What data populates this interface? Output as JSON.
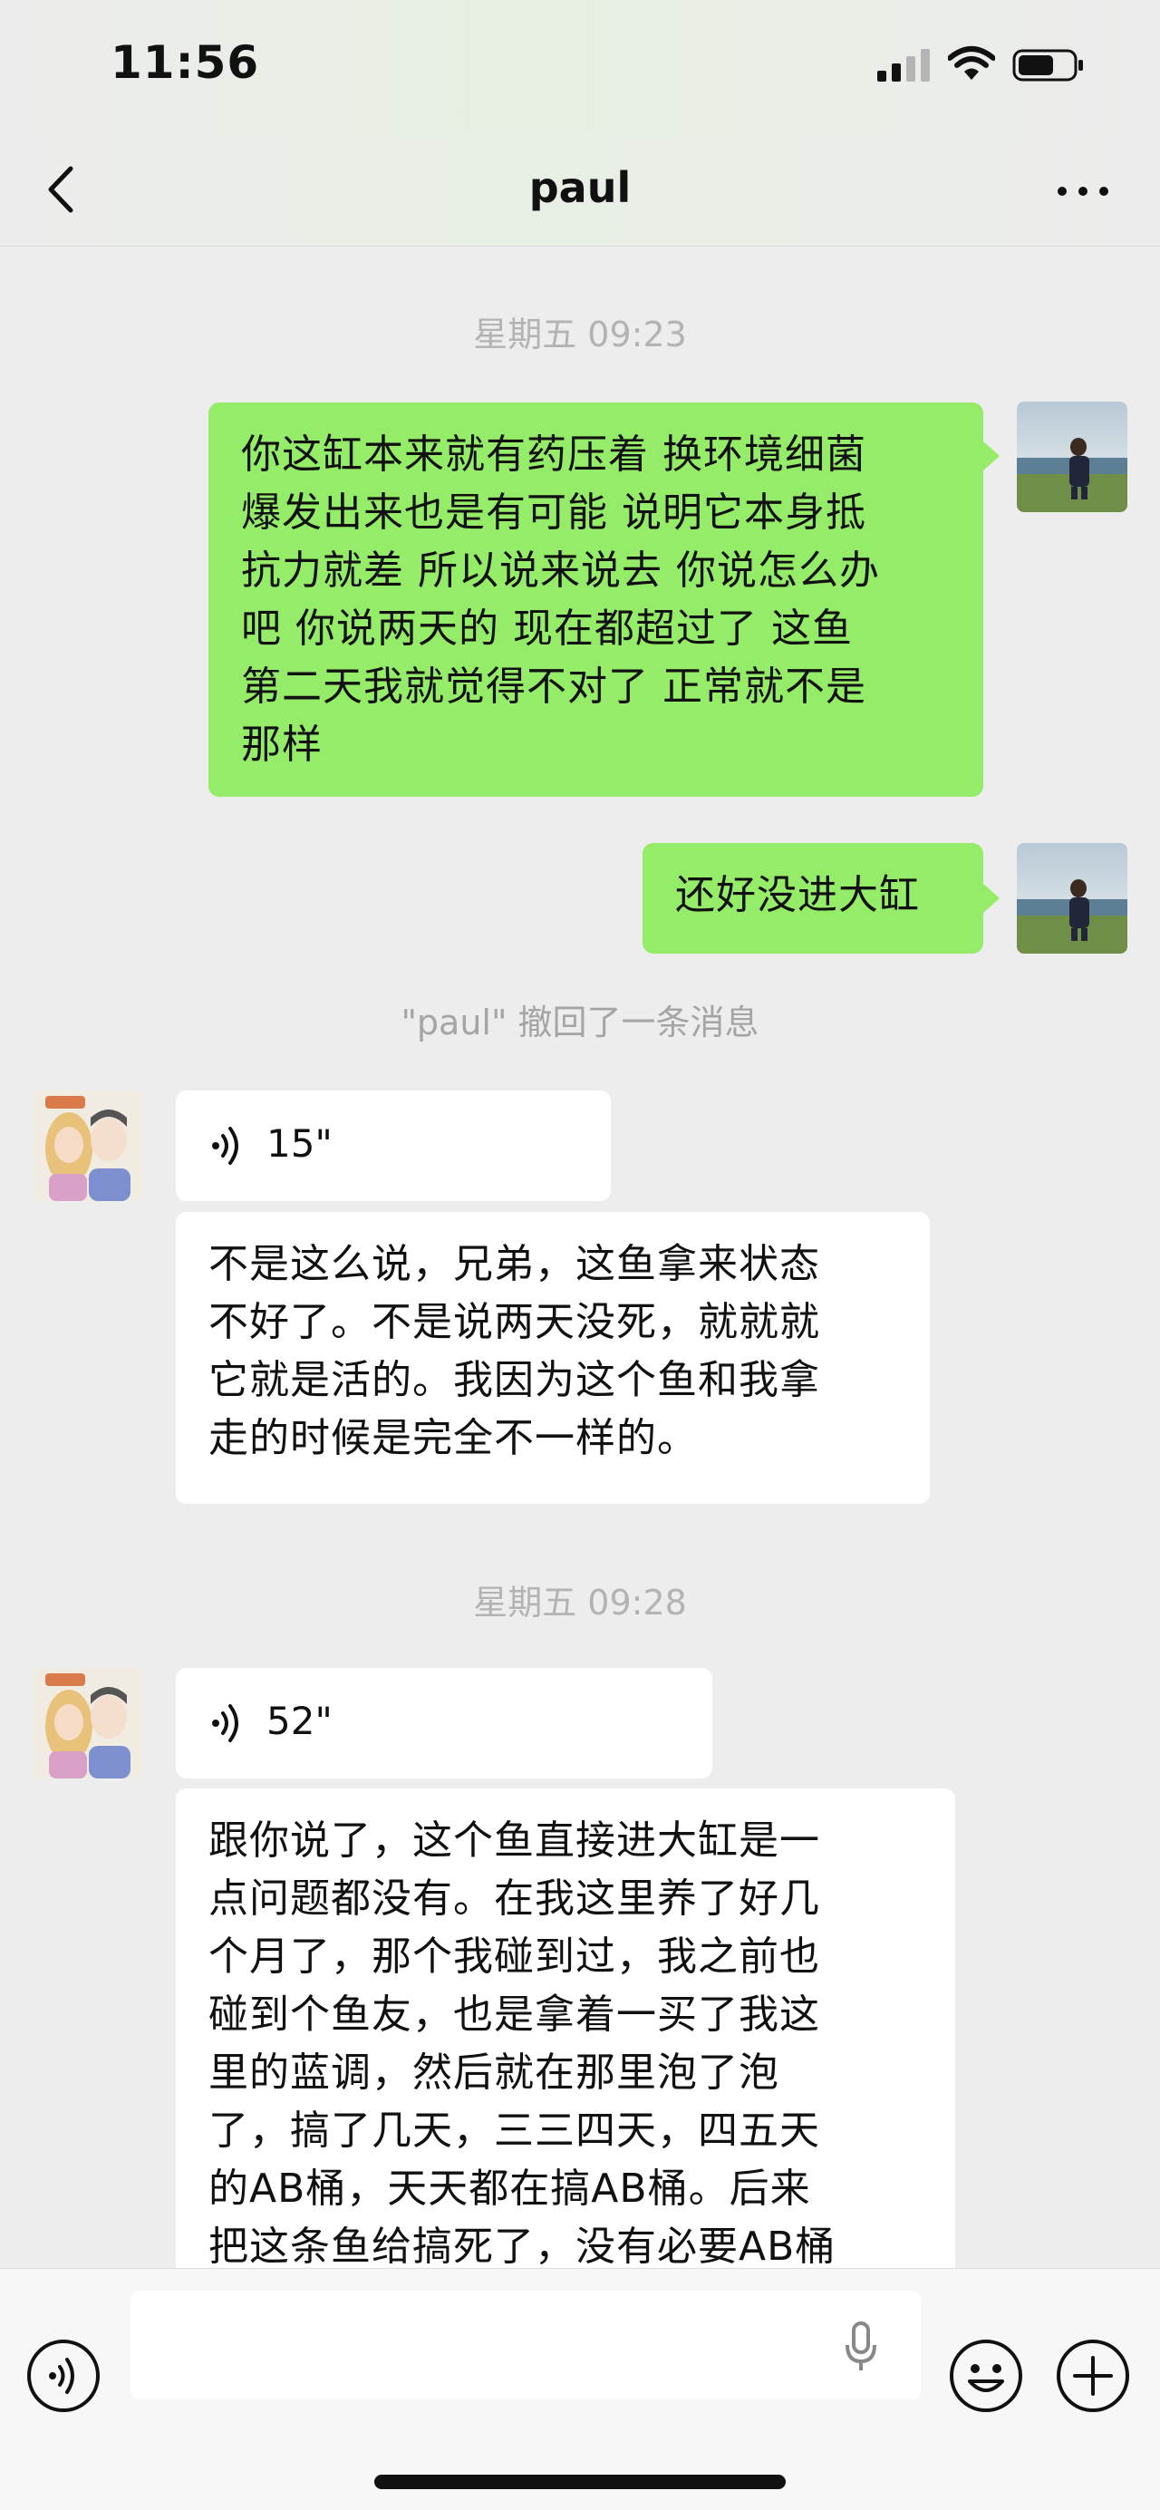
{
  "status_bar": {
    "time": "11:56"
  },
  "header": {
    "title": "paul"
  },
  "timestamps": [
    "星期五 09:23",
    "星期五 09:28"
  ],
  "messages": {
    "m1": "你这缸本来就有药压着 换环境细菌\n爆发出来也是有可能 说明它本身抵\n抗力就差 所以说来说去 你说怎么办\n吧 你说两天的 现在都超过了   这鱼\n第二天我就觉得不对了 正常就不是\n那样",
    "m2": "还好没进大缸",
    "recall_notice": "\"paul\" 撤回了一条消息",
    "voice1_duration": "15\"",
    "m3": "不是这么说，兄弟，这鱼拿来状态\n不好了。不是说两天没死，就就就\n它就是活的。我因为这个鱼和我拿\n走的时候是完全不一样的。",
    "voice2_duration": "52\"",
    "m4": "跟你说了，这个鱼直接进大缸是一\n点问题都没有。在我这里养了好几\n个月了，那个我碰到过，我之前也\n碰到个鱼友，也是拿着一买了我这\n里的蓝调，然后就在那里泡了泡\n了，搞了几天，三三四天，四五天\n的AB桶，天天都在搞AB桶。后来\n把这条鱼给搞死了，没有必要AB桶"
  },
  "colors": {
    "outgoing_bubble": "#95ec69",
    "incoming_bubble": "#ffffff",
    "background": "#ededed"
  }
}
